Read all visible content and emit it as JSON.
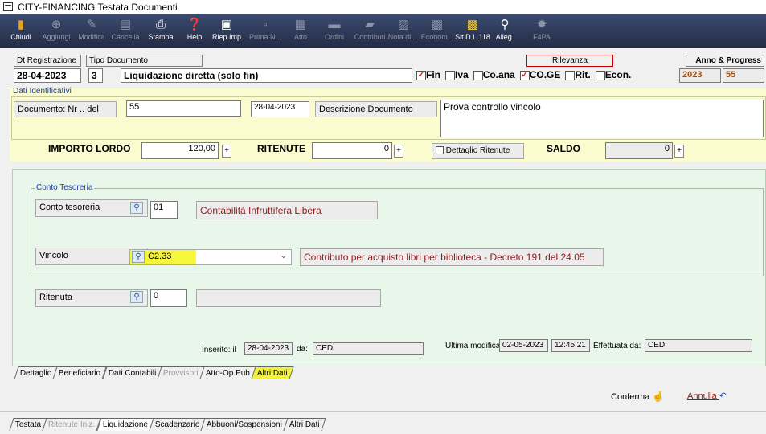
{
  "window": {
    "title": "CITY-FINANCING  Testata Documenti"
  },
  "toolbar": [
    {
      "label": "Chiudi",
      "icon": "close-icon",
      "enabled": true
    },
    {
      "label": "Aggiungi",
      "icon": "add-icon",
      "enabled": false
    },
    {
      "label": "Modifica",
      "icon": "edit-icon",
      "enabled": false
    },
    {
      "label": "Cancella",
      "icon": "delete-icon",
      "enabled": false
    },
    {
      "label": "Stampa",
      "icon": "print-icon",
      "enabled": true
    },
    {
      "label": "Help",
      "icon": "help-icon",
      "enabled": true
    },
    {
      "label": "Riep.Imp",
      "icon": "summary-icon",
      "enabled": true
    },
    {
      "label": "Prima N...",
      "icon": "first-note-icon",
      "enabled": false
    },
    {
      "label": "Atto",
      "icon": "act-icon",
      "enabled": false
    },
    {
      "label": "Ordini",
      "icon": "orders-icon",
      "enabled": false
    },
    {
      "label": "Contributi",
      "icon": "contributions-icon",
      "enabled": false
    },
    {
      "label": "Nota di ...",
      "icon": "credit-note-icon",
      "enabled": false
    },
    {
      "label": "Econom...",
      "icon": "economy-icon",
      "enabled": false
    },
    {
      "label": "Sit.D.L.118",
      "icon": "dl118-icon",
      "enabled": true
    },
    {
      "label": "Alleg.",
      "icon": "attachment-icon",
      "enabled": true
    },
    {
      "label": "F4PA",
      "icon": "f4pa-icon",
      "enabled": false
    }
  ],
  "header": {
    "dt_registrazione_label": "Dt Registrazione",
    "dt_registrazione": "28-04-2023",
    "tipo_documento_label": "Tipo Documento",
    "tipo_code": "3",
    "tipo_desc": "Liquidazione diretta  (solo fin)",
    "rilevanza_label": "Rilevanza",
    "rilevanza": [
      {
        "label": "Fin",
        "checked": true
      },
      {
        "label": "Iva",
        "checked": false
      },
      {
        "label": "Co.ana",
        "checked": false
      },
      {
        "label": "CO.GE",
        "checked": true
      },
      {
        "label": "Rit.",
        "checked": false
      },
      {
        "label": "Econ.",
        "checked": false
      }
    ],
    "anno_label": "Anno & Progress",
    "anno": "2023",
    "progress": "55"
  },
  "dati": {
    "legend": "Dati Identificativi",
    "documento_label": "Documento: Nr .. del",
    "numero": "55",
    "data": "28-04-2023",
    "descrizione_label": "Descrizione Documento",
    "descrizione": "Prova controllo vincolo",
    "importo_label": "IMPORTO LORDO",
    "importo": "120,00",
    "ritenute_label": "RITENUTE",
    "ritenute": "0",
    "dettaglio_label": "Dettaglio Ritenute",
    "saldo_label": "SALDO",
    "saldo": "0",
    "plus": "+"
  },
  "conto": {
    "legend": "Conto Tesoreria",
    "conto_label": "Conto tesoreria",
    "conto_code": "01",
    "conto_desc": "Contabilità Infruttifera Libera",
    "vincolo_label": "Vincolo",
    "vincolo_code": "C2.33",
    "vincolo_desc": "Contributo per acquisto libri per biblioteca - Decreto 191 del 24.05",
    "ritenuta_label": "Ritenuta",
    "ritenuta_code": "0",
    "ritenuta_desc": ""
  },
  "audit": {
    "inserito_label": "Inserito:  il",
    "inserito_date": "28-04-2023",
    "da_label": "da:",
    "inserito_user": "CED",
    "modifica_label": "Ultima modifica:",
    "modifica_date": "02-05-2023",
    "modifica_time": "12:45:21",
    "effettuata_label": "Effettuata da:",
    "modifica_user": "CED"
  },
  "inner_tabs": [
    {
      "label": "Dettaglio",
      "state": "normal"
    },
    {
      "label": "Beneficiario",
      "state": "normal"
    },
    {
      "label": "Dati Contabili",
      "state": "normal"
    },
    {
      "label": "Provvisori",
      "state": "disabled"
    },
    {
      "label": "Atto-Op.Pub",
      "state": "normal"
    },
    {
      "label": "Altri Dati",
      "state": "highlight"
    }
  ],
  "actions": {
    "conferma": "Conferma",
    "annulla": "Annulla"
  },
  "bottom_tabs": [
    {
      "label": "Testata",
      "state": "normal"
    },
    {
      "label": "Ritenute Iniz.",
      "state": "disabled"
    },
    {
      "label": "Liquidazione",
      "state": "active"
    },
    {
      "label": "Scadenzario",
      "state": "normal"
    },
    {
      "label": "Abbuoni/Sospensioni",
      "state": "normal"
    },
    {
      "label": "Altri Dati",
      "state": "normal"
    }
  ],
  "colors": {
    "toolbar": "#2a3452",
    "green_panel": "#e8f7ea",
    "yellow_bar": "#fbfbd0",
    "highlight": "#f2f23a",
    "dark_red": "#8b1c1c",
    "legend_blue": "#1a3ea0"
  }
}
